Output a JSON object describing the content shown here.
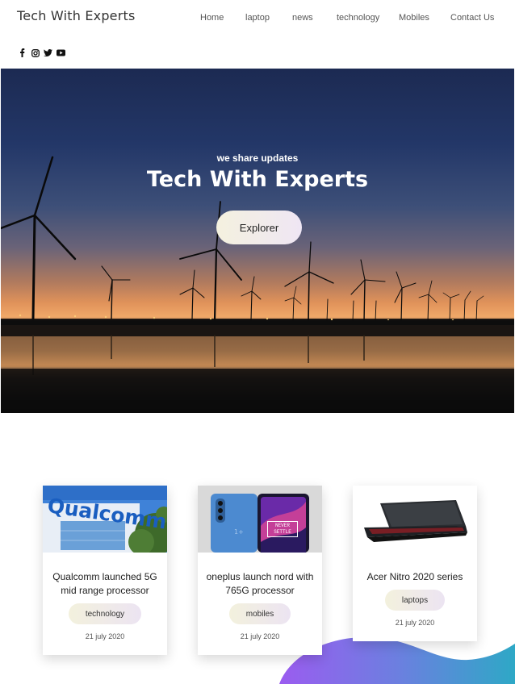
{
  "header": {
    "brand": "Tech With Experts",
    "nav": [
      "Home",
      "laptop",
      "news",
      "technology",
      "Mobiles",
      "Contact Us"
    ],
    "social_icons": [
      "facebook-icon",
      "instagram-icon",
      "twitter-icon",
      "youtube-icon"
    ]
  },
  "hero": {
    "subtitle": "we share updates",
    "title": "Tech With Experts",
    "button": "Explorer"
  },
  "cards": [
    {
      "image": "qualcomm-building-image",
      "title": "Qualcomm launched 5G mid range processor",
      "tag": "technology",
      "date": "21 july 2020",
      "logo_text": "Qualcomm"
    },
    {
      "image": "oneplus-nord-phones-image",
      "title": "oneplus launch nord with 765G processor",
      "tag": "mobiles",
      "date": "21 july 2020",
      "logo_text": "NEVER SETTLE"
    },
    {
      "image": "acer-nitro-laptop-image",
      "title": "Acer Nitro 2020 series",
      "tag": "laptops",
      "date": "21 july 2020"
    }
  ],
  "colors": {
    "blob_start": "#9b5cf0",
    "blob_end": "#2ea8c6",
    "pill_start": "#f3f1dd",
    "pill_end": "#ece4f2"
  }
}
